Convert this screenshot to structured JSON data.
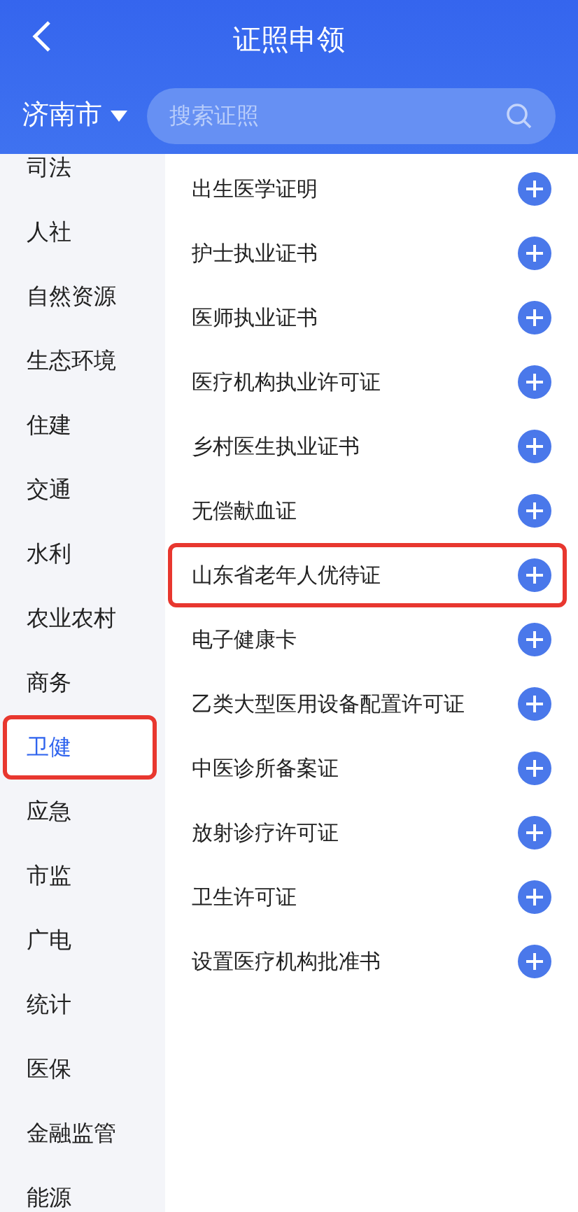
{
  "header": {
    "title": "证照申领"
  },
  "city": {
    "label": "济南市"
  },
  "search": {
    "placeholder": "搜索证照"
  },
  "sidebar": {
    "items": [
      {
        "label": "司法",
        "selected": false,
        "highlighted": false
      },
      {
        "label": "人社",
        "selected": false,
        "highlighted": false
      },
      {
        "label": "自然资源",
        "selected": false,
        "highlighted": false
      },
      {
        "label": "生态环境",
        "selected": false,
        "highlighted": false
      },
      {
        "label": "住建",
        "selected": false,
        "highlighted": false
      },
      {
        "label": "交通",
        "selected": false,
        "highlighted": false
      },
      {
        "label": "水利",
        "selected": false,
        "highlighted": false
      },
      {
        "label": "农业农村",
        "selected": false,
        "highlighted": false
      },
      {
        "label": "商务",
        "selected": false,
        "highlighted": false
      },
      {
        "label": "卫健",
        "selected": true,
        "highlighted": true
      },
      {
        "label": "应急",
        "selected": false,
        "highlighted": false
      },
      {
        "label": "市监",
        "selected": false,
        "highlighted": false
      },
      {
        "label": "广电",
        "selected": false,
        "highlighted": false
      },
      {
        "label": "统计",
        "selected": false,
        "highlighted": false
      },
      {
        "label": "医保",
        "selected": false,
        "highlighted": false
      },
      {
        "label": "金融监管",
        "selected": false,
        "highlighted": false
      },
      {
        "label": "能源",
        "selected": false,
        "highlighted": false
      }
    ]
  },
  "certificates": [
    {
      "label": "出生医学证明",
      "highlighted": false
    },
    {
      "label": "护士执业证书",
      "highlighted": false
    },
    {
      "label": "医师执业证书",
      "highlighted": false
    },
    {
      "label": "医疗机构执业许可证",
      "highlighted": false
    },
    {
      "label": "乡村医生执业证书",
      "highlighted": false
    },
    {
      "label": "无偿献血证",
      "highlighted": false
    },
    {
      "label": "山东省老年人优待证",
      "highlighted": true
    },
    {
      "label": "电子健康卡",
      "highlighted": false
    },
    {
      "label": "乙类大型医用设备配置许可证",
      "highlighted": false
    },
    {
      "label": "中医诊所备案证",
      "highlighted": false
    },
    {
      "label": "放射诊疗许可证",
      "highlighted": false
    },
    {
      "label": "卫生许可证",
      "highlighted": false
    },
    {
      "label": "设置医疗机构批准书",
      "highlighted": false
    }
  ]
}
